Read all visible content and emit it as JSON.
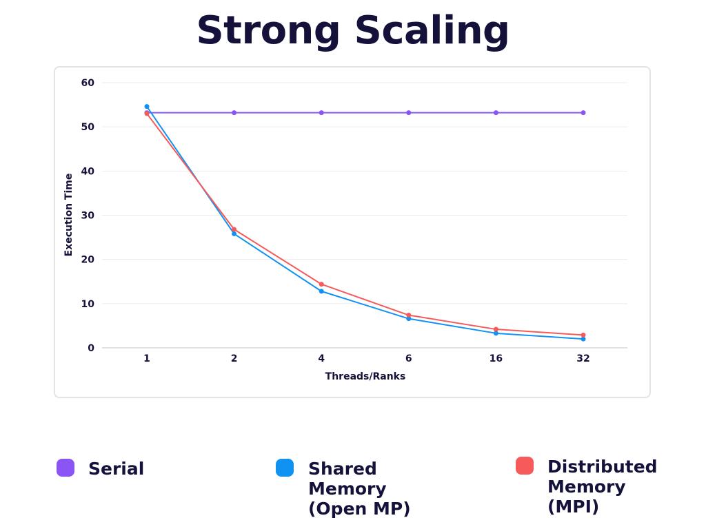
{
  "title": "Strong Scaling",
  "chart_data": {
    "type": "line",
    "categories": [
      "1",
      "2",
      "4",
      "6",
      "16",
      "32"
    ],
    "xlabel": "Threads/Ranks",
    "ylabel": "Execution Time",
    "ylim": [
      0,
      60
    ],
    "yticks": [
      0,
      10,
      20,
      30,
      40,
      50,
      60
    ],
    "grid": true,
    "legend_position": "bottom",
    "series": [
      {
        "name": "Serial",
        "color": "#8b55f6",
        "values": [
          53.2,
          53.2,
          53.2,
          53.2,
          53.2,
          53.2
        ]
      },
      {
        "name": "Shared Memory (Open MP)",
        "color": "#1192f2",
        "values": [
          54.6,
          25.8,
          12.8,
          6.6,
          3.3,
          2.0
        ]
      },
      {
        "name": "Distributed Memory (MPI)",
        "color": "#f65a5a",
        "values": [
          53.0,
          26.8,
          14.4,
          7.4,
          4.2,
          2.9
        ]
      }
    ]
  },
  "legend": [
    {
      "label": "Serial",
      "color": "#8b55f6"
    },
    {
      "label": "Shared\nMemory\n(Open MP)",
      "color": "#1192f2"
    },
    {
      "label": "Distributed\nMemory\n(MPI)",
      "color": "#f65a5a"
    }
  ]
}
